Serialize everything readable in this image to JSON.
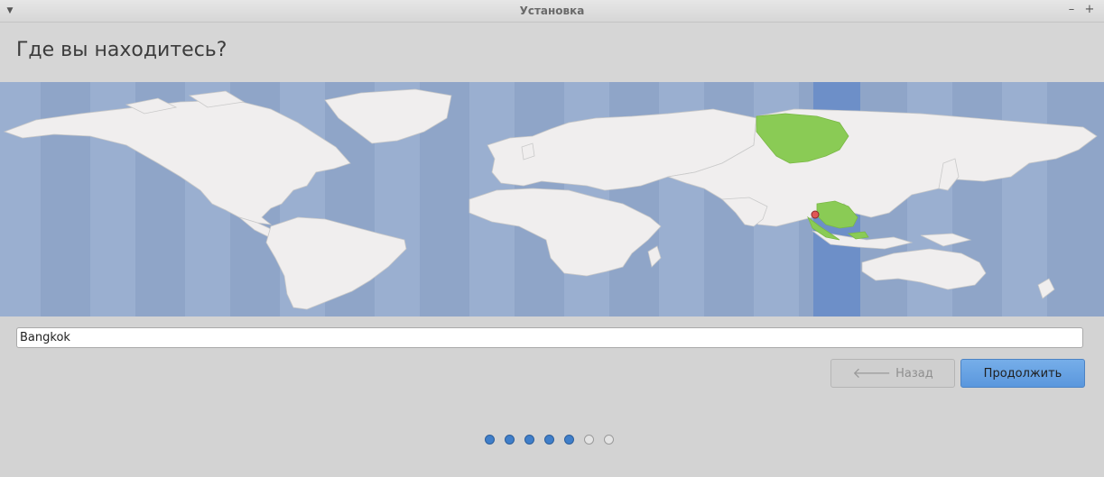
{
  "window": {
    "title": "Установка"
  },
  "page": {
    "heading": "Где вы находитесь?"
  },
  "timezone": {
    "value": "Bangkok",
    "highlight_color": "#8acb55",
    "marker_color": "#e05656"
  },
  "buttons": {
    "back_label": "Назад",
    "continue_label": "Продолжить"
  },
  "progress": {
    "total_steps": 7,
    "completed_steps": 5
  }
}
